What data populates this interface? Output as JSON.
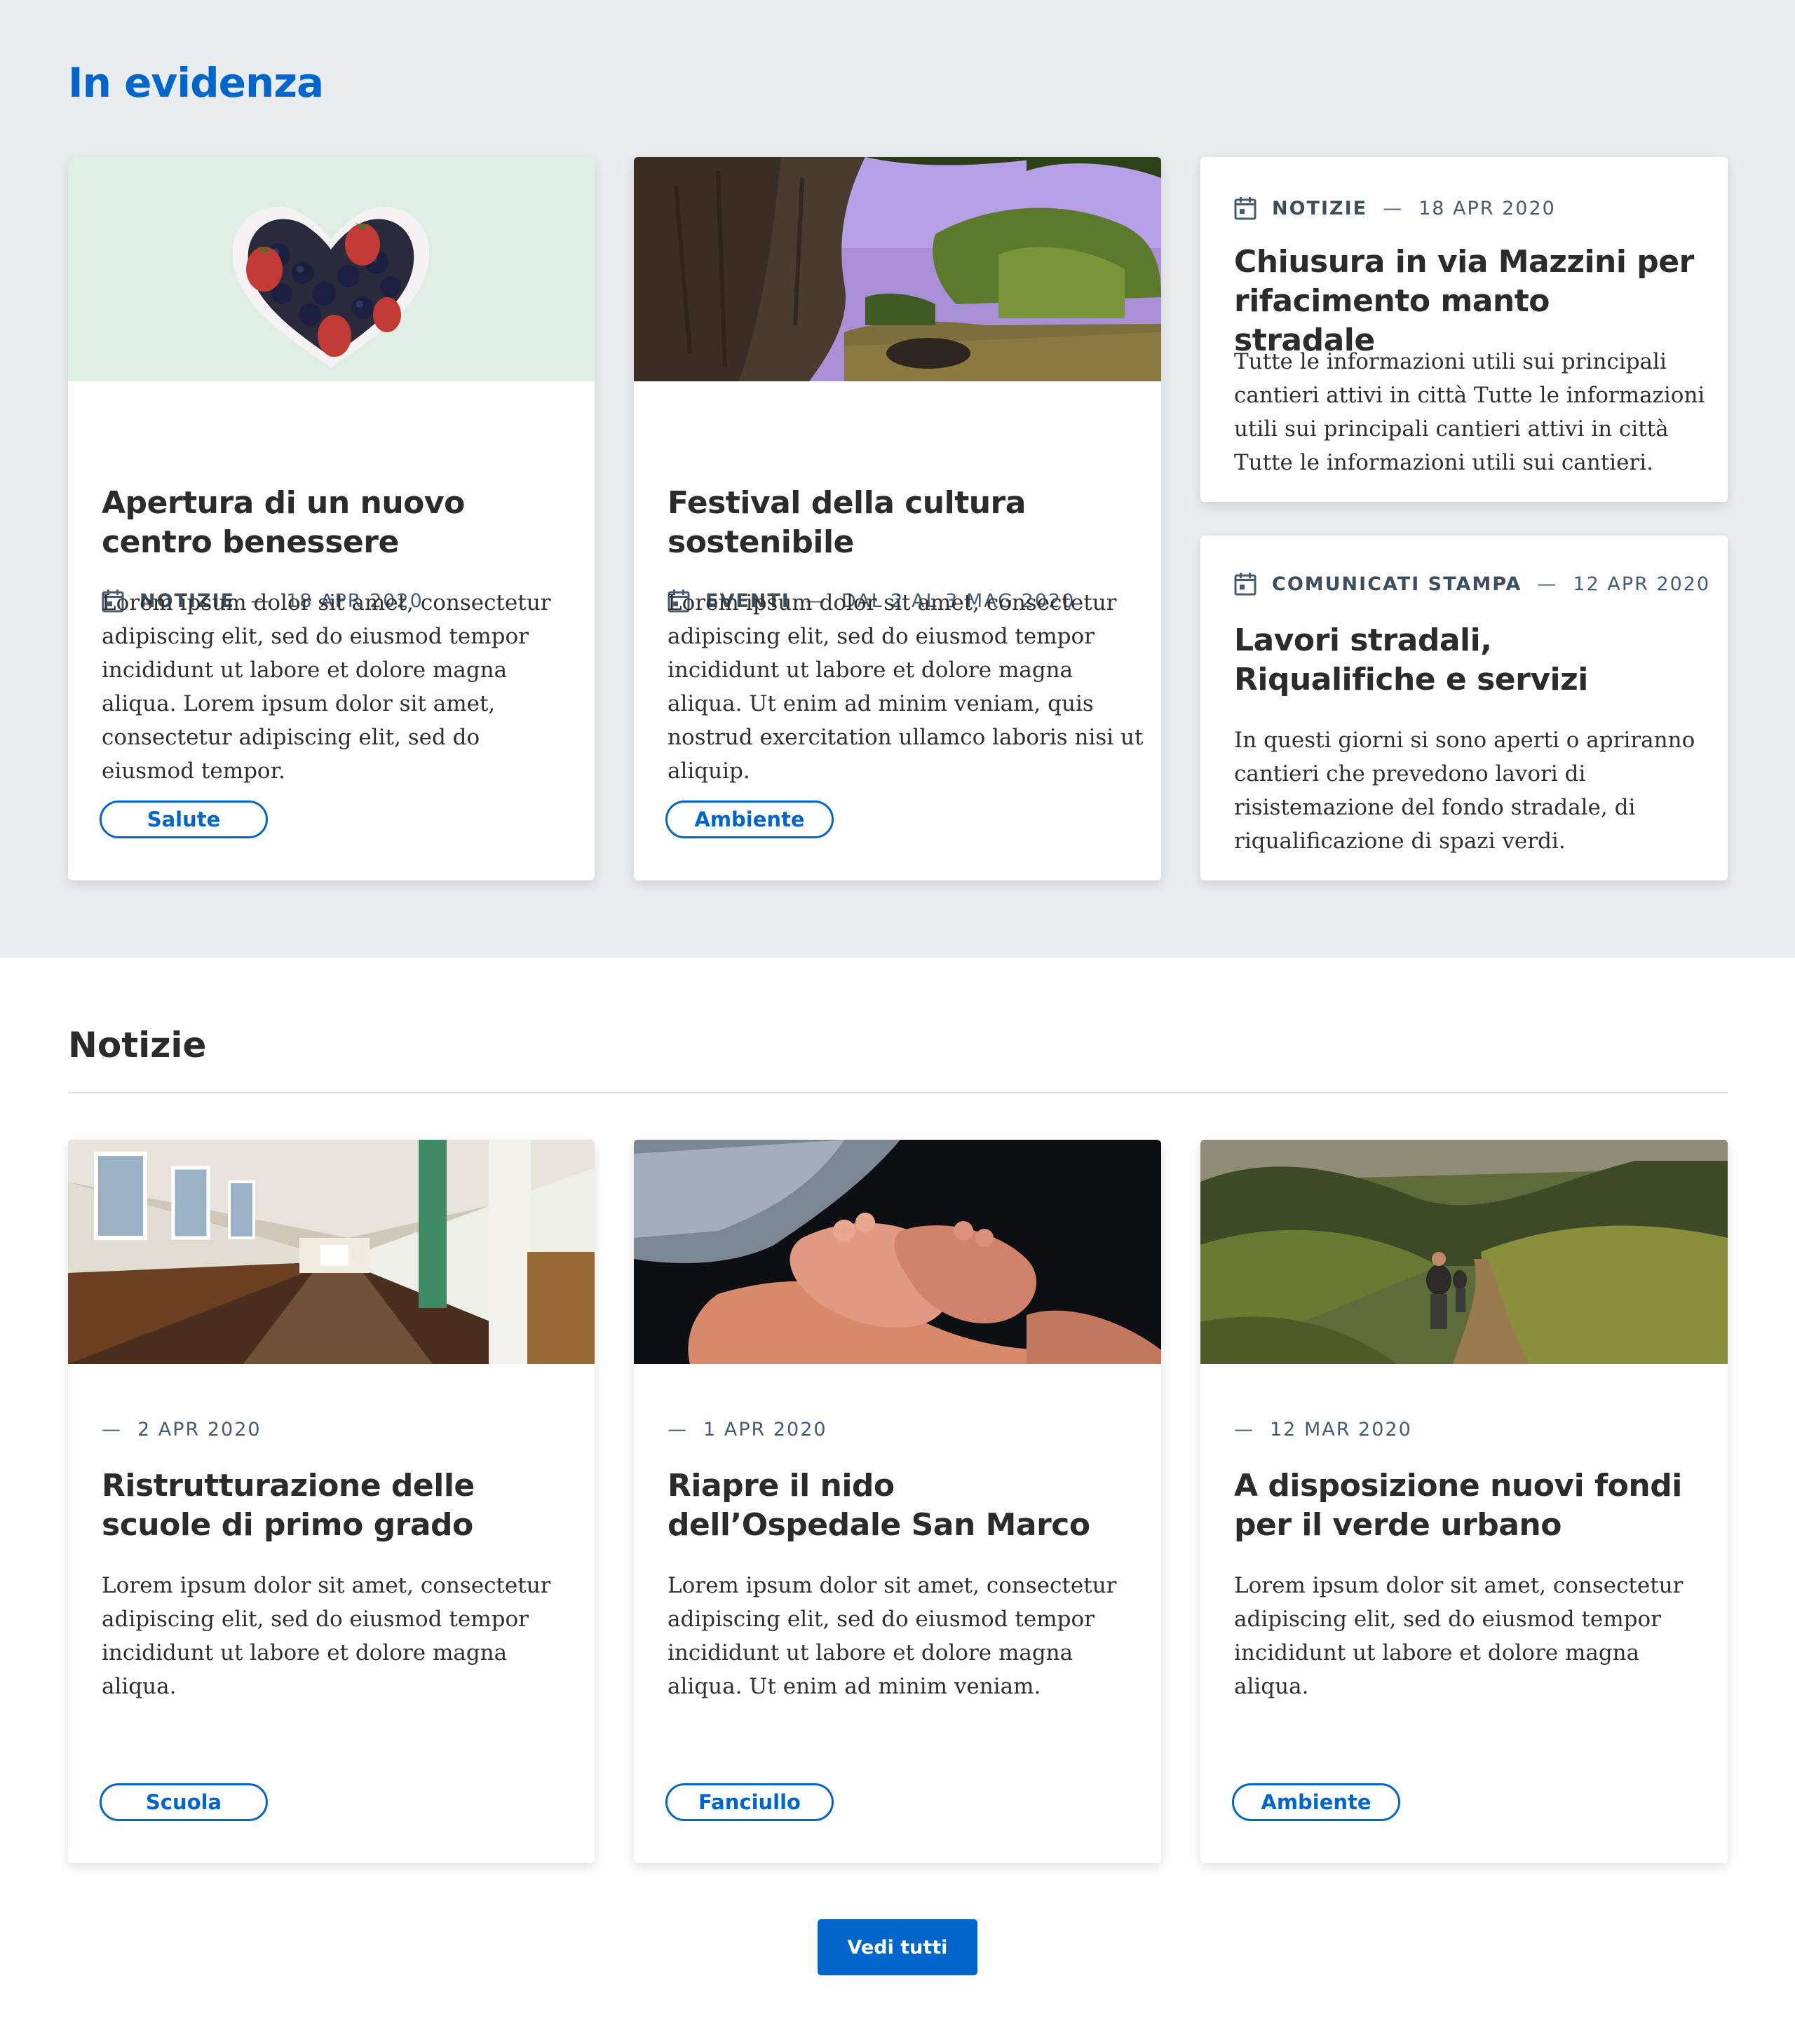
{
  "featured": {
    "title": "In evidenza",
    "cards": [
      {
        "category": "NOTIZIE",
        "date": "18 APR 2020",
        "title": "Apertura di un nuovo centro benessere",
        "text": "Lorem ipsum dolor sit amet, consectetur adipiscing elit, sed do eiusmod tempor incididunt ut labore et dolore magna aliqua. Lorem ipsum dolor sit amet, consectetur adipiscing elit, sed do eiusmod tempor.",
        "tag": "Salute",
        "image": "heart-bowl-of-berries"
      },
      {
        "category": "EVENTI",
        "date": "DAL 2 AL 3 MAG 2020",
        "title": "Festival della cultura sostenibile",
        "text": "Lorem ipsum dolor sit amet, consectetur adipiscing elit, sed do eiusmod tempor incididunt ut labore et dolore magna aliqua. Ut enim ad minim veniam, quis nostrud exercitation ullamco laboris nisi ut aliquip.",
        "tag": "Ambiente",
        "image": "tree-trunk-landscape"
      },
      {
        "category": "NOTIZIE",
        "date": "18 APR 2020",
        "title": "Chiusura in via Mazzini per rifacimento manto stradale",
        "text": "Tutte le informazioni utili sui principali cantieri attivi in città Tutte le informazioni utili sui principali cantieri attivi in città Tutte le informazioni utili sui cantieri."
      },
      {
        "category": "COMUNICATI STAMPA",
        "date": "12 APR 2020",
        "title": "Lavori stradali, Riqualifiche e servizi",
        "text": "In questi giorni si sono aperti o apriranno cantieri che prevedono lavori di risistemazione del fondo stradale, di riqualificazione di spazi verdi."
      }
    ]
  },
  "news": {
    "title": "Notizie",
    "cards": [
      {
        "date": "2 APR 2020",
        "title": "Ristrutturazione delle scuole di primo grado",
        "text": "Lorem ipsum dolor sit amet, consectetur adipiscing elit, sed do eiusmod tempor incididunt ut labore et dolore magna aliqua.",
        "tag": "Scuola",
        "image": "school-corridor"
      },
      {
        "date": "1 APR 2020",
        "title": "Riapre il nido dell’Ospedale San Marco",
        "text": "Lorem ipsum dolor sit amet, consectetur adipiscing elit, sed do eiusmod tempor incididunt ut labore et dolore magna aliqua. Ut enim ad minim veniam.",
        "tag": "Fanciullo",
        "image": "baby-feet-in-hands"
      },
      {
        "date": "12 MAR 2020",
        "title": "A disposizione nuovi fondi per il verde urbano",
        "text": "Lorem ipsum dolor sit amet, consectetur adipiscing elit, sed do eiusmod tempor incididunt ut labore et dolore magna aliqua.",
        "tag": "Ambiente",
        "image": "hikers-mountain-trail"
      }
    ],
    "view_all_label": "Vedi tutti"
  },
  "colors": {
    "primary": "#0066cc",
    "featured_background": "#eaedf0",
    "meta_text": "#455b71"
  },
  "icons": {
    "calendar": "calendar-icon"
  }
}
